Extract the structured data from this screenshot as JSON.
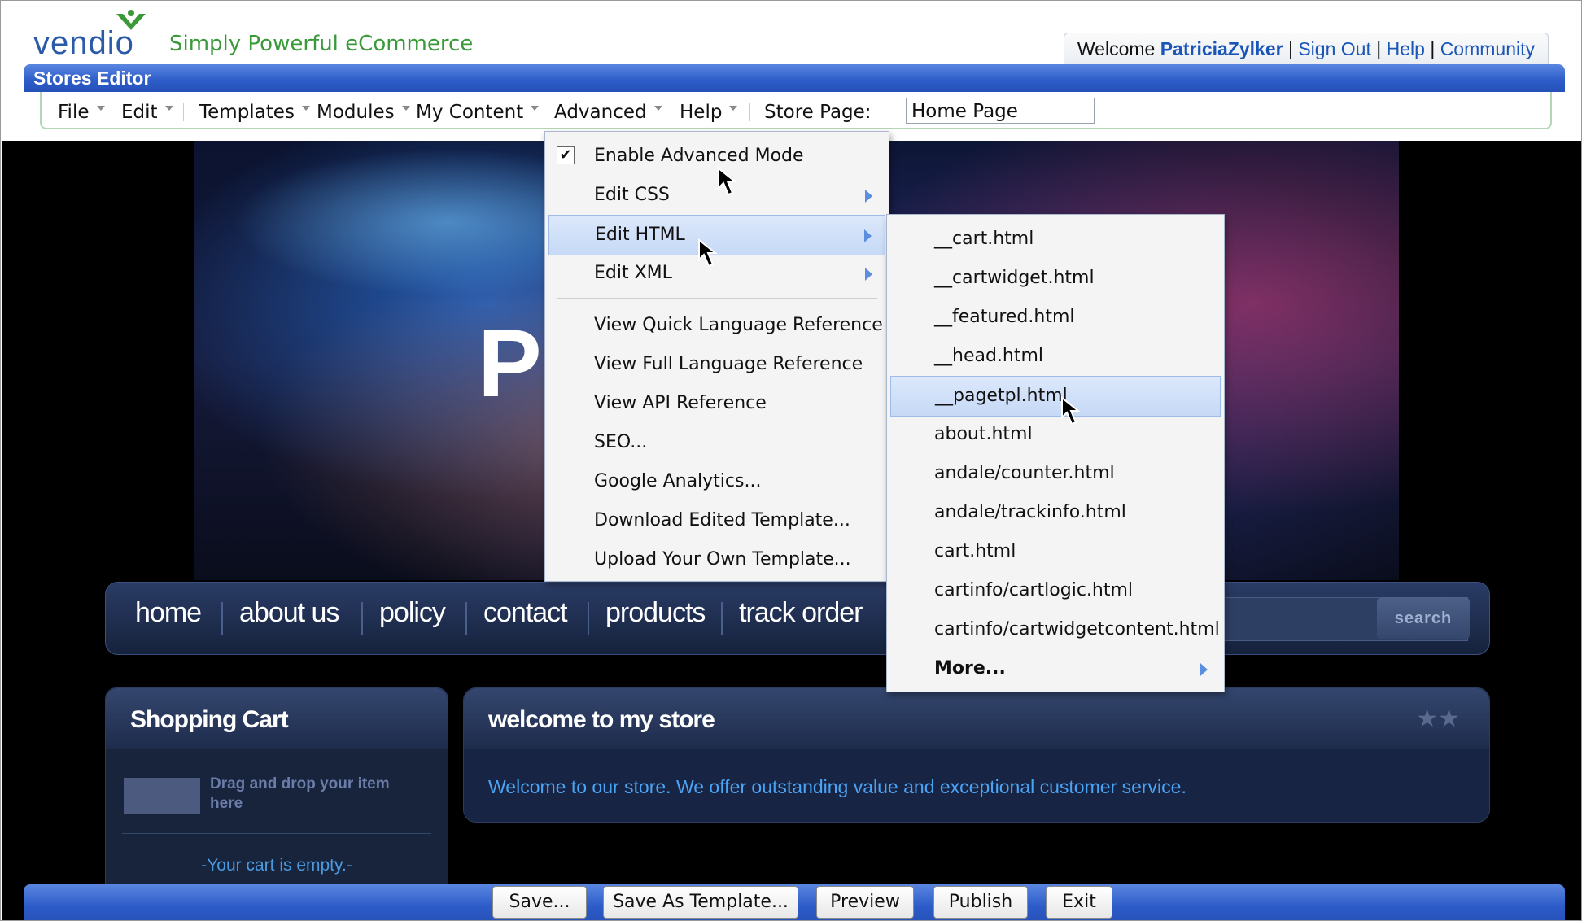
{
  "header": {
    "logo_text": "vendio",
    "tagline": "Simply Powerful eCommerce",
    "welcome_prefix": "Welcome",
    "username": "PatriciaZylker",
    "sign_out": "Sign Out",
    "help": "Help",
    "community": "Community"
  },
  "editor": {
    "title": "Stores Editor"
  },
  "menubar": {
    "items": [
      "File",
      "Edit",
      "Templates",
      "Modules",
      "My Content",
      "Advanced",
      "Help"
    ],
    "store_page_label": "Store Page:",
    "store_page_value": "Home Page"
  },
  "advanced_menu": {
    "items": [
      {
        "label": "Enable Advanced Mode",
        "checked": true
      },
      {
        "label": "Edit CSS",
        "submenu": true
      },
      {
        "label": "Edit HTML",
        "submenu": true,
        "highlighted": true
      },
      {
        "label": "Edit XML",
        "submenu": true
      },
      {
        "label": "View Quick Language Reference"
      },
      {
        "label": "View Full Language Reference"
      },
      {
        "label": "View API Reference"
      },
      {
        "label": "SEO..."
      },
      {
        "label": "Google Analytics..."
      },
      {
        "label": "Download Edited Template..."
      },
      {
        "label": "Upload Your Own Template..."
      }
    ]
  },
  "html_submenu": {
    "items": [
      "__cart.html",
      "__cartwidget.html",
      "__featured.html",
      "__head.html",
      "__pagetpl.html",
      "about.html",
      "andale/counter.html",
      "andale/trackinfo.html",
      "cart.html",
      "cartinfo/cartlogic.html",
      "cartinfo/cartwidgetcontent.html"
    ],
    "highlighted": "__pagetpl.html",
    "more_label": "More..."
  },
  "store": {
    "banner_letter": "P",
    "nav": [
      "home",
      "about us",
      "policy",
      "contact",
      "products",
      "track order"
    ],
    "search_button": "search",
    "cart_title": "Shopping Cart",
    "cart_drag_text": "Drag and drop your item here",
    "cart_empty": "-Your cart is empty.-",
    "welcome_title": "welcome to my store",
    "welcome_text": "Welcome to our store. We offer outstanding value and exceptional customer service."
  },
  "bottom_buttons": [
    "Save...",
    "Save As Template...",
    "Preview",
    "Publish",
    "Exit"
  ],
  "colors": {
    "accent_blue": "#2c5bc8",
    "link_blue": "#1a56b8",
    "tagline_green": "#3a9a3a",
    "store_text_blue": "#4aa4f4"
  }
}
